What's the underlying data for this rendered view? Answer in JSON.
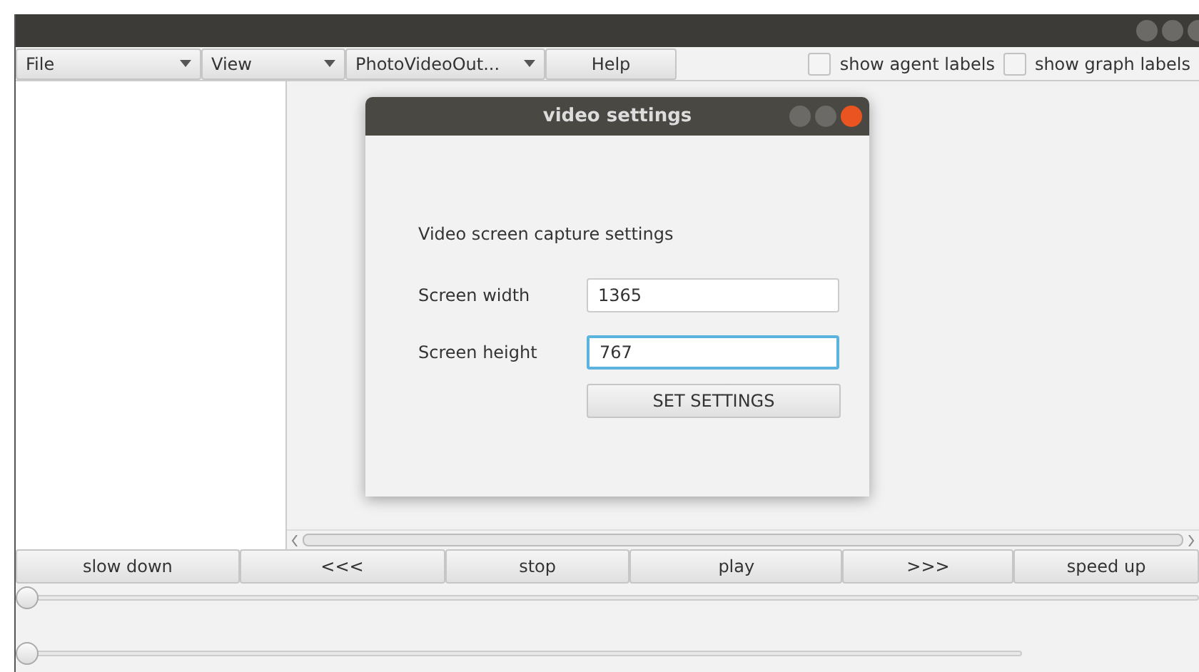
{
  "menu_bar": [
    {
      "label": "File",
      "kind": "dropdown"
    },
    {
      "label": "View",
      "kind": "dropdown"
    },
    {
      "label": "PhotoVideoOut...",
      "kind": "dropdown"
    },
    {
      "label": "Help",
      "kind": "button"
    }
  ],
  "toggles": [
    {
      "label": "show agent labels",
      "checked": false
    },
    {
      "label": "show graph labels",
      "checked": false
    }
  ],
  "dialog": {
    "title": "video settings",
    "heading": "Video screen capture settings",
    "fields": [
      {
        "label": "Screen width",
        "value": "1365",
        "focused": false
      },
      {
        "label": "Screen height",
        "value": "767",
        "focused": true
      }
    ],
    "button": "SET SETTINGS"
  },
  "controls": [
    "slow down",
    "<<<",
    "stop",
    "play",
    ">>>",
    "speed up"
  ],
  "sliders": [
    {
      "level": 0
    },
    {
      "level": 0
    }
  ]
}
